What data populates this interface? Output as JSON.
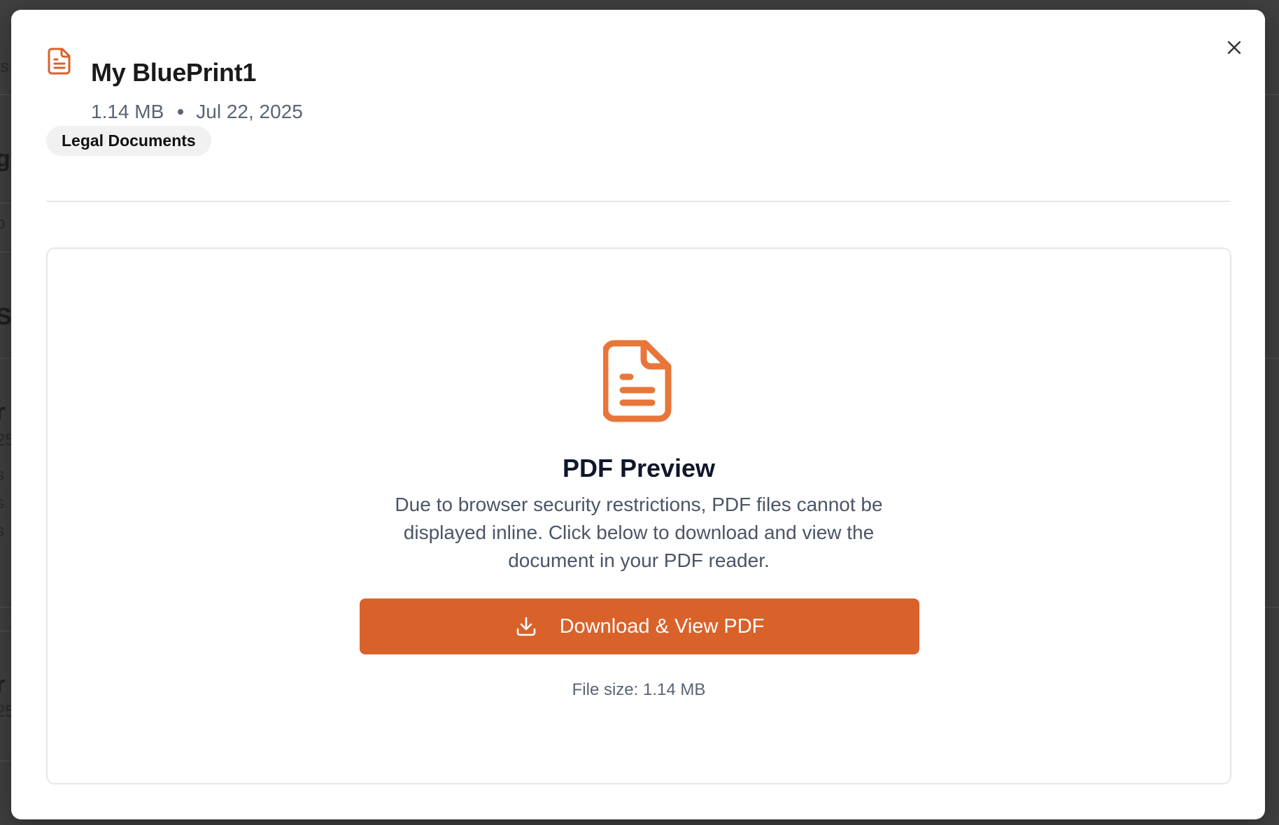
{
  "background_fragments": {
    "frag_1": "ts",
    "frag_2": "g",
    "frag_3": "p",
    "frag_4": "S",
    "frag_5": "r",
    "frag_6": "25",
    "frag_7": "s",
    "frag_8": "s",
    "frag_9": "s",
    "frag_10": "r",
    "frag_11": "25"
  },
  "modal": {
    "title": "My BluePrint1",
    "file_size": "1.14 MB",
    "date": "Jul 22, 2025",
    "category_tag": "Legal Documents",
    "close_icon": "close-icon",
    "header_icon": "file-text-icon",
    "accent_color": "#d9622b"
  },
  "preview": {
    "icon": "file-text-icon",
    "title": "PDF Preview",
    "description": "Due to browser security restrictions, PDF files cannot be displayed inline. Click below to download and view the document in your PDF reader.",
    "download_button_label": "Download & View PDF",
    "download_icon": "download-icon",
    "file_size_note": "File size: 1.14 MB",
    "button_color": "#d9622b",
    "icon_color": "#e8763a"
  }
}
